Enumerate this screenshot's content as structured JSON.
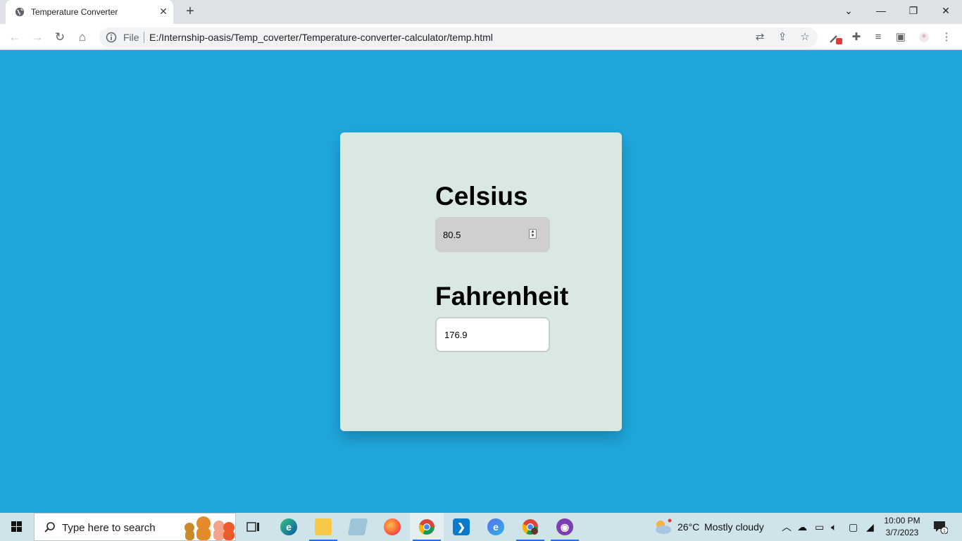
{
  "browser": {
    "tab": {
      "title": "Temperature Converter"
    },
    "address": {
      "scheme_label": "File",
      "url": "E:/Internship-oasis/Temp_coverter/Temperature-converter-calculator/temp.html"
    }
  },
  "converter": {
    "celsius_label": "Celsius",
    "celsius_value": "80.5",
    "fahrenheit_label": "Fahrenheit",
    "fahrenheit_value": "176.9"
  },
  "taskbar": {
    "search_placeholder": "Type here to search",
    "apps": [
      "task-view",
      "edge",
      "file-explorer",
      "notepad",
      "firefox",
      "chrome",
      "vscode",
      "cortana-edge",
      "chrome-profile",
      "github-desktop"
    ],
    "weather": {
      "temperature": "26°C",
      "condition": "Mostly cloudy"
    },
    "clock": {
      "time": "10:00 PM",
      "date": "3/7/2023"
    },
    "notification_count": "1"
  },
  "colors": {
    "page_background": "#1fa7dc",
    "card_background": "#d9e9e2",
    "celsius_field": "#cfcfcf"
  }
}
